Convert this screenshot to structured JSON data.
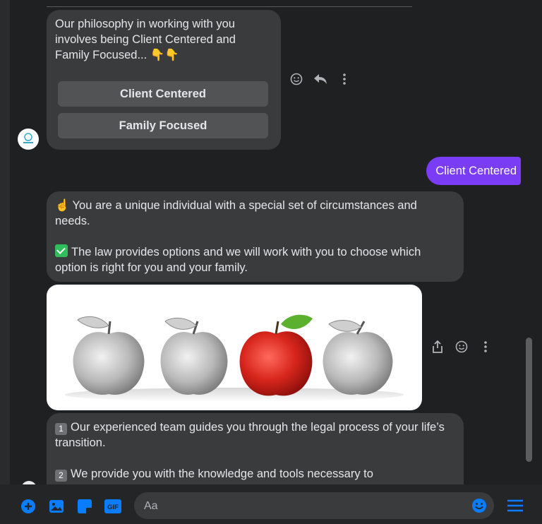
{
  "messages": {
    "intro": {
      "text": "Our philosophy in working with you involves being Client Centered and Family Focused... 👇👇",
      "quick_replies": [
        "Client Centered",
        "Family Focused"
      ]
    },
    "sent_reply": "Client Centered",
    "bullets": {
      "line1_emoji": "☝️",
      "line1": "You are a unique individual with a special set of circumstances and needs.",
      "line2": "The law provides options and we will work with you to choose which option is right for you and your family."
    },
    "image": {
      "description_icon": "apples-image"
    },
    "numbered": {
      "n1": "1",
      "line1": "Our experienced team guides you through the legal process of your life’s transition.",
      "n2": "2",
      "line2": "We provide you with the knowledge and tools necessary to"
    }
  },
  "composer": {
    "placeholder": "Aa",
    "gif_label": "GIF"
  },
  "colors": {
    "accent": "#0a7cff",
    "sent_bubble": "#7b3cf5",
    "received_bubble": "#3a3b3c"
  }
}
